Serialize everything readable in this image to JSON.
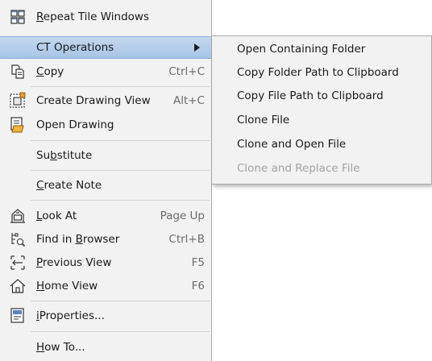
{
  "menu": {
    "items": [
      {
        "id": "repeat-tile-windows",
        "pre": "",
        "u": "R",
        "post": "epeat Tile Windows",
        "shortcut": "",
        "icon": "tile-windows-icon"
      },
      {
        "id": "ct-operations",
        "pre": "",
        "u": "",
        "post": "CT Operations",
        "shortcut": "",
        "icon": ""
      },
      {
        "id": "copy",
        "pre": "",
        "u": "C",
        "post": "opy",
        "shortcut": "Ctrl+C",
        "icon": "copy-icon"
      },
      {
        "id": "create-drawing-view",
        "pre": "",
        "u": "",
        "post": "Create Drawing View",
        "shortcut": "Alt+C",
        "icon": "drawing-view-icon"
      },
      {
        "id": "open-drawing",
        "pre": "",
        "u": "",
        "post": "Open Drawing",
        "shortcut": "",
        "icon": "open-drawing-icon"
      },
      {
        "id": "substitute",
        "pre": "Su",
        "u": "b",
        "post": "stitute",
        "shortcut": "",
        "icon": ""
      },
      {
        "id": "create-note",
        "pre": "",
        "u": "C",
        "post": "reate Note",
        "shortcut": "",
        "icon": ""
      },
      {
        "id": "look-at",
        "pre": "",
        "u": "L",
        "post": "ook At",
        "shortcut": "Page Up",
        "icon": "look-at-icon"
      },
      {
        "id": "find-in-browser",
        "pre": "Find in ",
        "u": "B",
        "post": "rowser",
        "shortcut": "Ctrl+B",
        "icon": "find-browser-icon"
      },
      {
        "id": "previous-view",
        "pre": "",
        "u": "P",
        "post": "revious View",
        "shortcut": "F5",
        "icon": "previous-view-icon"
      },
      {
        "id": "home-view",
        "pre": "",
        "u": "H",
        "post": "ome View",
        "shortcut": "F6",
        "icon": "home-view-icon"
      },
      {
        "id": "iproperties",
        "pre": "",
        "u": "i",
        "post": "Properties...",
        "shortcut": "",
        "icon": "iproperties-icon"
      },
      {
        "id": "how-to",
        "pre": "",
        "u": "H",
        "post": "ow To...",
        "shortcut": "",
        "icon": ""
      }
    ]
  },
  "submenu": {
    "items": [
      {
        "id": "open-containing-folder",
        "label": "Open Containing Folder",
        "enabled": true
      },
      {
        "id": "copy-folder-path",
        "label": "Copy Folder Path to Clipboard",
        "enabled": true
      },
      {
        "id": "copy-file-path",
        "label": "Copy File Path to Clipboard",
        "enabled": true
      },
      {
        "id": "clone-file",
        "label": "Clone File",
        "enabled": true
      },
      {
        "id": "clone-and-open-file",
        "label": "Clone and Open File",
        "enabled": true
      },
      {
        "id": "clone-and-replace-file",
        "label": "Clone and Replace File",
        "enabled": false
      }
    ]
  },
  "colors": {
    "highlight": "#b6cdeb",
    "menu_bg": "#f2f2f2",
    "disabled_text": "#a3a3a3",
    "shortcut_text": "#6b6b6b"
  }
}
